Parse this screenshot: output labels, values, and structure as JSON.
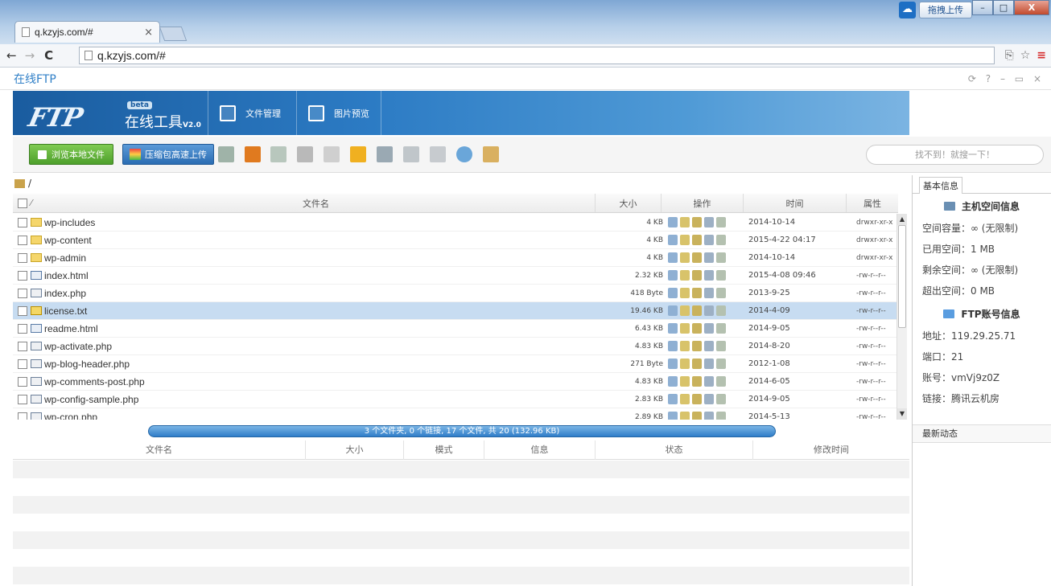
{
  "browser": {
    "tab_title": "q.kzyjs.com/#",
    "tab_close": "×",
    "url": "q.kzyjs.com/#",
    "upload_button": "拖拽上传",
    "nav_back": "←",
    "nav_forward": "→",
    "nav_reload": "C",
    "window_controls": [
      "–",
      "□",
      "X"
    ],
    "right_icons": [
      "⎘",
      "☆",
      "≡"
    ]
  },
  "app": {
    "title": "在线FTP",
    "controls": "⟳ ? – ▭ ×",
    "logo": {
      "text": "FTP",
      "beta": "beta",
      "subtitle": "在线工具",
      "version": "V2.0"
    },
    "nav": [
      {
        "label": "文件管理",
        "icon": "file-manage-icon"
      },
      {
        "label": "图片预览",
        "icon": "image-preview-icon"
      }
    ]
  },
  "toolbar": {
    "browse_local": "浏览本地文件",
    "zip_upload": "压缩包高速上传",
    "search_placeholder": "找不到！就搜一下！",
    "icons": [
      "upload-icon",
      "new-folder-icon",
      "move-icon",
      "delete-icon",
      "settings-icon",
      "copy-icon",
      "permissions-icon",
      "grid-icon",
      "export-icon",
      "refresh-icon",
      "archive-icon"
    ]
  },
  "file_list": {
    "path": "/",
    "columns": {
      "name": "文件名",
      "size": "大小",
      "ops": "操作",
      "time": "时间",
      "perm": "属性"
    },
    "rows": [
      {
        "name": "wp-includes",
        "type": "folder",
        "size": "4 KB",
        "time": "2014-10-14",
        "perm": "drwxr-xr-x"
      },
      {
        "name": "wp-content",
        "type": "folder",
        "size": "4 KB",
        "time": "2015-4-22 04:17",
        "perm": "drwxr-xr-x"
      },
      {
        "name": "wp-admin",
        "type": "folder",
        "size": "4 KB",
        "time": "2014-10-14",
        "perm": "drwxr-xr-x"
      },
      {
        "name": "index.html",
        "type": "html",
        "size": "2.32 KB",
        "time": "2015-4-08 09:46",
        "perm": "-rw-r--r--"
      },
      {
        "name": "index.php",
        "type": "php",
        "size": "418 Byte",
        "time": "2013-9-25",
        "perm": "-rw-r--r--"
      },
      {
        "name": "license.txt",
        "type": "txt",
        "size": "19.46 KB",
        "time": "2014-4-09",
        "perm": "-rw-r--r--",
        "selected": true
      },
      {
        "name": "readme.html",
        "type": "html",
        "size": "6.43 KB",
        "time": "2014-9-05",
        "perm": "-rw-r--r--"
      },
      {
        "name": "wp-activate.php",
        "type": "php",
        "size": "4.83 KB",
        "time": "2014-8-20",
        "perm": "-rw-r--r--"
      },
      {
        "name": "wp-blog-header.php",
        "type": "php",
        "size": "271 Byte",
        "time": "2012-1-08",
        "perm": "-rw-r--r--"
      },
      {
        "name": "wp-comments-post.php",
        "type": "php",
        "size": "4.83 KB",
        "time": "2014-6-05",
        "perm": "-rw-r--r--"
      },
      {
        "name": "wp-config-sample.php",
        "type": "php",
        "size": "2.83 KB",
        "time": "2014-9-05",
        "perm": "-rw-r--r--"
      },
      {
        "name": "wp-cron.php",
        "type": "php",
        "size": "2.89 KB",
        "time": "2014-5-13",
        "perm": "-rw-r--r--"
      }
    ],
    "status": "3 个文件夹, 0 个链接, 17 个文件, 共 20 (132.96 KB)"
  },
  "transfer": {
    "columns": [
      "文件名",
      "大小",
      "模式",
      "信息",
      "状态",
      "修改时间"
    ]
  },
  "info": {
    "tab": "基本信息",
    "host_header": "主机空间信息",
    "host_items": [
      "空间容量：∞ (无限制)",
      "已用空间：1 MB",
      "剩余空间：∞ (无限制)",
      "超出空间：0 MB"
    ],
    "ftp_header": "FTP账号信息",
    "ftp_items": [
      "地址：119.29.25.71",
      "端口：21",
      "账号：vmVj9z0Z",
      "链接：腾讯云机房"
    ],
    "recent": "最新动态"
  },
  "colors": {
    "accent": "#2f7fc7",
    "selected_row": "#c7dcf1",
    "green_button": "#5aab34"
  }
}
